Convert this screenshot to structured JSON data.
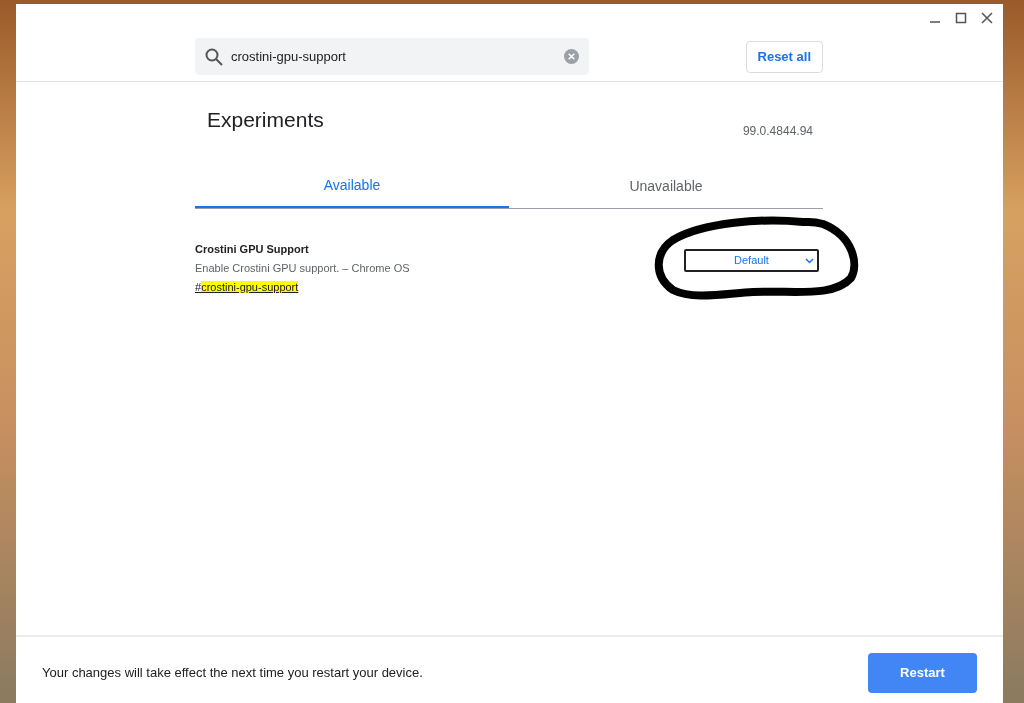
{
  "search": {
    "value": "crostini-gpu-support"
  },
  "reset_button": "Reset all",
  "title": "Experiments",
  "version": "99.0.4844.94",
  "tabs": [
    {
      "label": "Available",
      "selected": true
    },
    {
      "label": "Unavailable",
      "selected": false
    }
  ],
  "flags": [
    {
      "name": "Crostini GPU Support",
      "description": "Enable Crostini GPU support. – Chrome OS",
      "anchor_prefix": "#",
      "anchor_match": "crostini-gpu-support",
      "dropdown": "Default",
      "circled": true
    }
  ],
  "footer": {
    "message": "Your changes will take effect the next time you restart your device.",
    "button": "Restart"
  }
}
